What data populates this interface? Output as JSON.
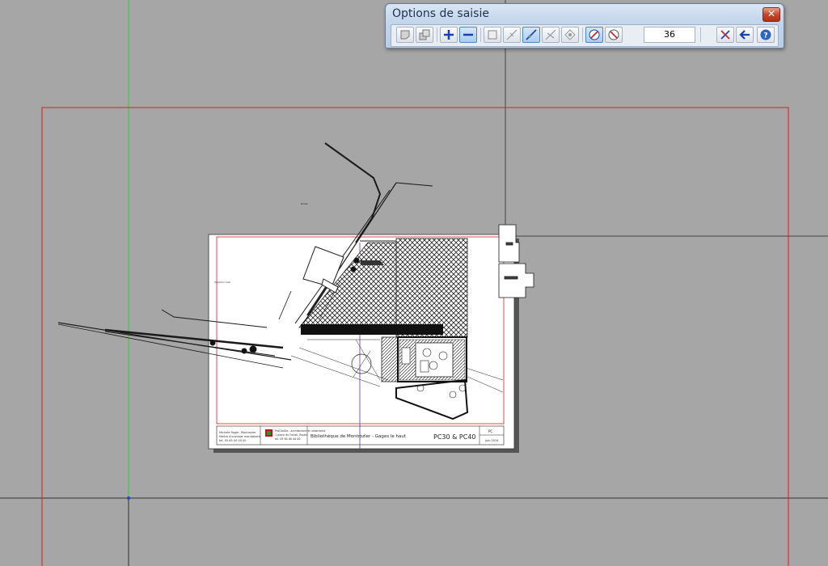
{
  "palette": {
    "title": "Options de saisie",
    "angle_value": "36",
    "tools": [
      {
        "name": "polygon-mode-button",
        "icon": "polygon-icon",
        "active": false
      },
      {
        "name": "union-mode-button",
        "icon": "union-icon",
        "active": false
      },
      {
        "name": "add-mode-button",
        "icon": "plus-icon",
        "active": false
      },
      {
        "name": "subtract-mode-button",
        "icon": "minus-icon",
        "active": true
      },
      {
        "name": "rectangle-snap-button",
        "icon": "square-icon",
        "active": false
      },
      {
        "name": "midpoint-snap-button",
        "icon": "midpoint-icon",
        "active": false
      },
      {
        "name": "line-snap-button",
        "icon": "line-icon",
        "active": true
      },
      {
        "name": "perpendicular-snap-button",
        "icon": "perpendicular-icon",
        "active": false
      },
      {
        "name": "intersection-snap-button",
        "icon": "intersection-icon",
        "active": false
      },
      {
        "name": "angle-lock-button",
        "icon": "angle-lock-icon",
        "active": true
      },
      {
        "name": "angle-free-button",
        "icon": "angle-free-icon",
        "active": false
      },
      {
        "name": "clear-snap-button",
        "icon": "clear-snap-icon",
        "active": false
      },
      {
        "name": "back-button",
        "icon": "arrow-left-icon",
        "active": false
      },
      {
        "name": "help-button",
        "icon": "help-icon",
        "active": false
      }
    ]
  },
  "sheet": {
    "title_block_text": "Bibliothèque de Montrozier - Gages le haut",
    "sheet_code": "PC30 & PC40",
    "ref_code": "PC",
    "date_label": "Juin 2014"
  },
  "colors": {
    "background": "#a6a6a6",
    "frame_red": "#e01c1c",
    "axis_green": "#33c233",
    "sheet_white": "#ffffff"
  }
}
